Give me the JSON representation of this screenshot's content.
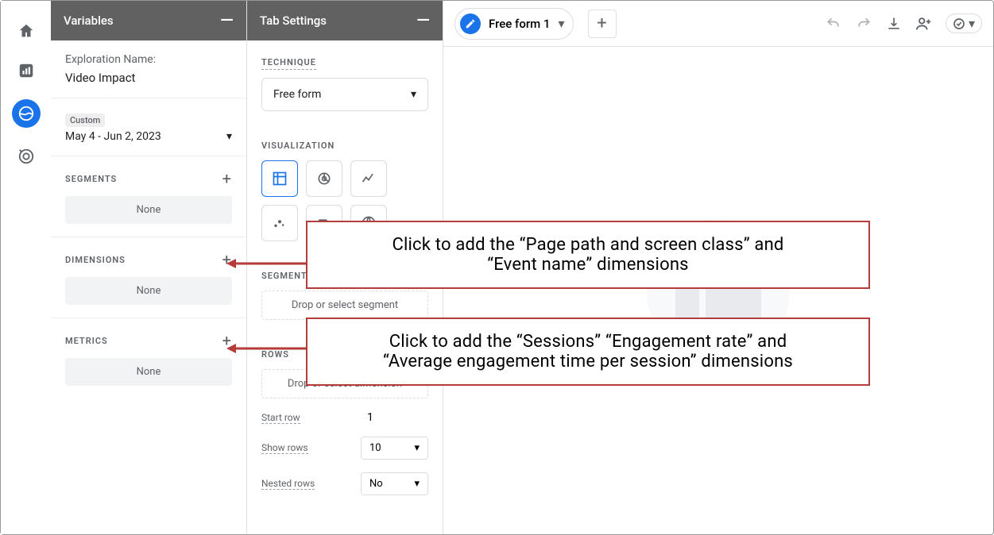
{
  "panels": {
    "variables_title": "Variables",
    "tab_settings_title": "Tab Settings"
  },
  "exploration": {
    "name_label": "Exploration Name:",
    "name_value": "Video Impact",
    "date_custom_label": "Custom",
    "date_range": "May 4 - Jun 2, 2023"
  },
  "segments": {
    "label": "SEGMENTS",
    "empty": "None"
  },
  "dimensions": {
    "label": "DIMENSIONS",
    "empty": "None"
  },
  "metrics": {
    "label": "METRICS",
    "empty": "None"
  },
  "technique": {
    "label": "TECHNIQUE",
    "value": "Free form"
  },
  "visualization": {
    "label": "VISUALIZATION"
  },
  "segment_comparisons": {
    "label": "SEGMENT COMPARISONS",
    "drop": "Drop or select segment"
  },
  "rows": {
    "label": "ROWS",
    "drop": "Drop or select dimension",
    "start_row_label": "Start row",
    "start_row_value": "1",
    "show_rows_label": "Show rows",
    "show_rows_value": "10",
    "nested_rows_label": "Nested rows",
    "nested_rows_value": "No"
  },
  "tab": {
    "name": "Free form 1"
  },
  "callouts": {
    "dimensions_line1": "Click to add the “Page path and screen class” and",
    "dimensions_line2": "“Event name” dimensions",
    "metrics_line1": "Click to add the “Sessions” “Engagement rate” and",
    "metrics_line2": "“Average engagement time per session” dimensions"
  }
}
